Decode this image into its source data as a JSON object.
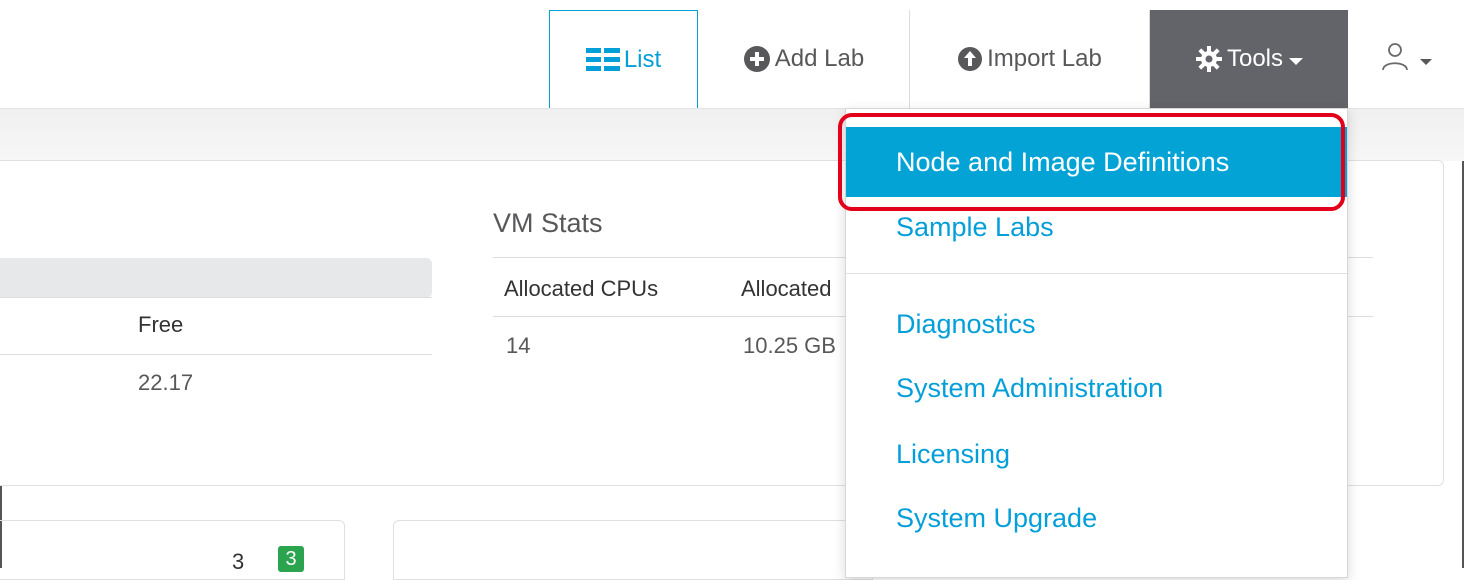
{
  "navbar": {
    "list_label": "List",
    "add_lab_label": "Add Lab",
    "import_lab_label": "Import Lab",
    "tools_label": "Tools",
    "icons": {
      "list": "list-grid-icon",
      "add": "plus-circle-icon",
      "import": "upload-circle-icon",
      "tools": "gear-icon",
      "user": "user-icon"
    }
  },
  "system_stats": {
    "columns": [
      "Free"
    ],
    "values": [
      "22.17"
    ]
  },
  "vm_stats": {
    "title": "VM Stats",
    "columns": [
      "Allocated CPUs",
      "Allocated"
    ],
    "values": [
      "14",
      "10.25 GB"
    ]
  },
  "bottom_panel": {
    "badge_plain": "3",
    "badge_green": "3"
  },
  "tools_menu": {
    "items": [
      "Node and Image Definitions",
      "Sample Labs",
      "Diagnostics",
      "System Administration",
      "Licensing",
      "System Upgrade"
    ],
    "active_index": 0
  },
  "colors": {
    "accent": "#049fd9",
    "tools_bg": "#626469",
    "active_item_bg": "#04a3d6",
    "highlight": "#e2001a",
    "badge_green": "#2aa44f"
  }
}
